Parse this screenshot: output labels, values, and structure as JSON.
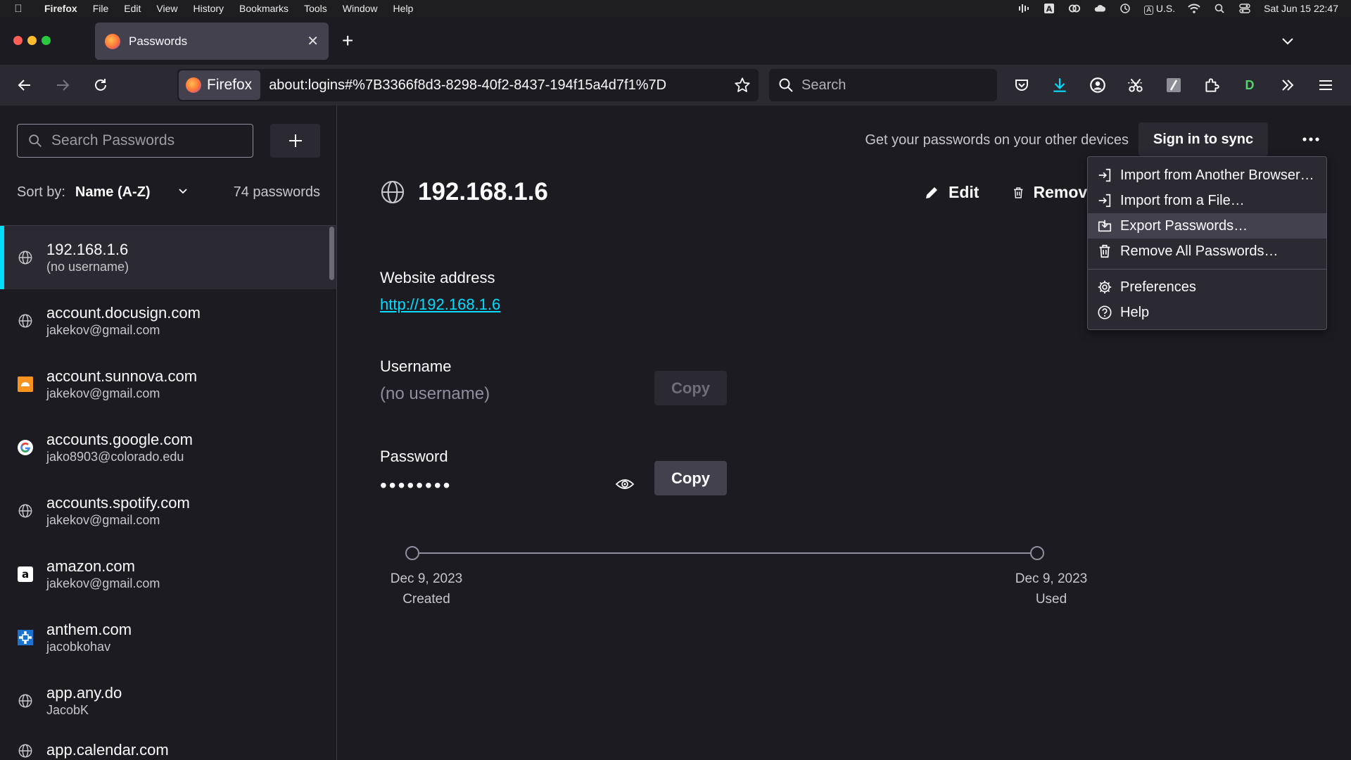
{
  "menubar": {
    "app": "Firefox",
    "items": [
      "File",
      "Edit",
      "View",
      "History",
      "Bookmarks",
      "Tools",
      "Window",
      "Help"
    ],
    "input_source": "U.S.",
    "clock": "Sat Jun 15  22:47"
  },
  "tab": {
    "title": "Passwords"
  },
  "toolbar": {
    "identity_label": "Firefox",
    "url": "about:logins#%7B3366f8d3-8298-40f2-8437-194f15a4d7f1%7D",
    "search_placeholder": "Search",
    "profile_letter": "D"
  },
  "sidebar": {
    "search_placeholder": "Search Passwords",
    "sort_label": "Sort by:",
    "sort_value": "Name (A-Z)",
    "count": "74 passwords",
    "items": [
      {
        "title": "192.168.1.6",
        "subtitle": "(no username)",
        "icon": "globe-icon"
      },
      {
        "title": "account.docusign.com",
        "subtitle": "jakekov@gmail.com",
        "icon": "globe-icon"
      },
      {
        "title": "account.sunnova.com",
        "subtitle": "jakekov@gmail.com",
        "icon": "sunnova-favicon"
      },
      {
        "title": "accounts.google.com",
        "subtitle": "jako8903@colorado.edu",
        "icon": "google-favicon"
      },
      {
        "title": "accounts.spotify.com",
        "subtitle": "jakekov@gmail.com",
        "icon": "globe-icon"
      },
      {
        "title": "amazon.com",
        "subtitle": "jakekov@gmail.com",
        "icon": "amazon-favicon"
      },
      {
        "title": "anthem.com",
        "subtitle": "jacobkohav",
        "icon": "anthem-favicon"
      },
      {
        "title": "app.any.do",
        "subtitle": "JacobK",
        "icon": "globe-icon"
      },
      {
        "title": "app.calendar.com",
        "subtitle": "",
        "icon": "globe-icon"
      }
    ]
  },
  "main": {
    "sync_text": "Get your passwords on your other devices",
    "sync_button": "Sign in to sync",
    "title": "192.168.1.6",
    "edit_label": "Edit",
    "remove_label": "Remove",
    "website_label": "Website address",
    "website_value": "http://192.168.1.6",
    "username_label": "Username",
    "username_value": "(no username)",
    "copy_label": "Copy",
    "password_label": "Password",
    "password_value": "••••••••",
    "created_date": "Dec 9, 2023",
    "created_label": "Created",
    "used_date": "Dec 9, 2023",
    "used_label": "Used"
  },
  "menu": {
    "items": [
      {
        "label": "Import from Another Browser…",
        "icon": "import-icon"
      },
      {
        "label": "Import from a File…",
        "icon": "import-icon"
      },
      {
        "label": "Export Passwords…",
        "icon": "export-icon",
        "active": true
      },
      {
        "label": "Remove All Passwords…",
        "icon": "trash-icon"
      },
      {
        "label": "Preferences",
        "icon": "gear-icon"
      },
      {
        "label": "Help",
        "icon": "help-icon"
      }
    ]
  },
  "colors": {
    "accent": "#00ddff",
    "background": "#1c1b22",
    "toolbar": "#2b2a33"
  }
}
